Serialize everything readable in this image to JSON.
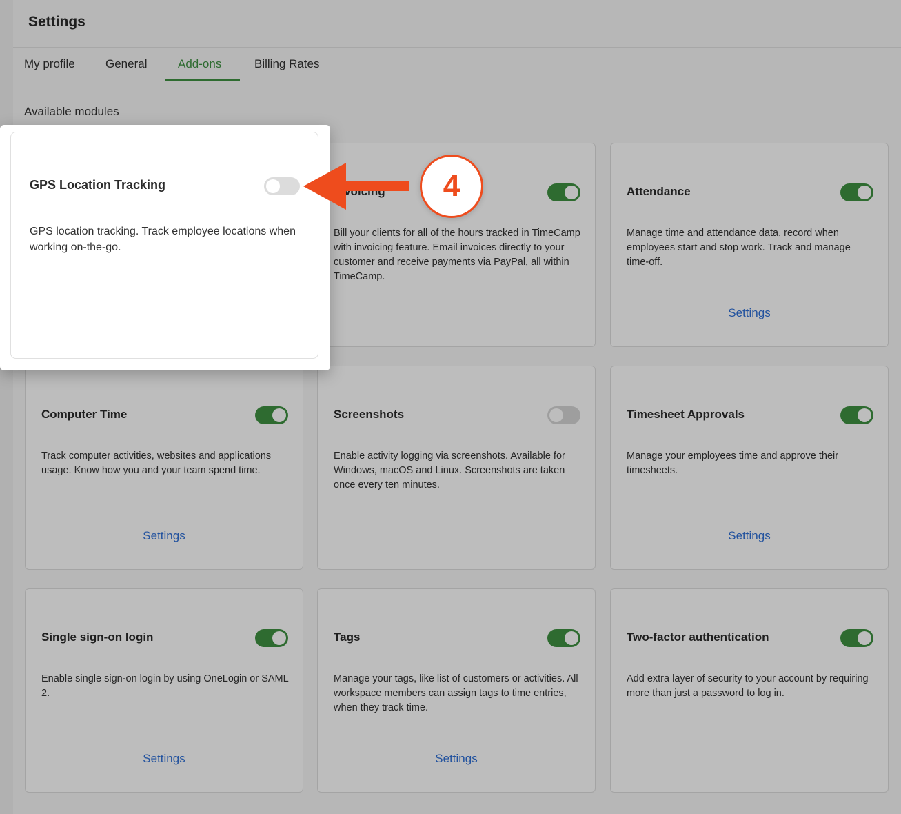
{
  "page": {
    "title": "Settings"
  },
  "tabs": [
    {
      "label": "My profile",
      "active": false
    },
    {
      "label": "General",
      "active": false
    },
    {
      "label": "Add-ons",
      "active": true
    },
    {
      "label": "Billing Rates",
      "active": false
    }
  ],
  "section_label": "Available modules",
  "modules": [
    {
      "title": "GPS Location Tracking",
      "enabled": false,
      "description": "GPS location tracking. Track employee locations when working on-the-go.",
      "settings_label": ""
    },
    {
      "title": "Invoicing",
      "enabled": true,
      "description": "Bill your clients for all of the hours tracked in TimeCamp with invoicing feature. Email invoices directly to your customer and receive payments via PayPal, all within TimeCamp.",
      "settings_label": ""
    },
    {
      "title": "Attendance",
      "enabled": true,
      "description": "Manage time and attendance data, record when employees start and stop work. Track and manage time-off.",
      "settings_label": "Settings"
    },
    {
      "title": "Computer Time",
      "enabled": true,
      "description": "Track computer activities, websites and applications usage. Know how you and your team spend time.",
      "settings_label": "Settings"
    },
    {
      "title": "Screenshots",
      "enabled": false,
      "description": "Enable activity logging via screenshots. Available for Windows, macOS and Linux. Screenshots are taken once every ten minutes.",
      "settings_label": ""
    },
    {
      "title": "Timesheet Approvals",
      "enabled": true,
      "description": "Manage your employees time and approve their timesheets.",
      "settings_label": "Settings"
    },
    {
      "title": "Single sign-on login",
      "enabled": true,
      "description": "Enable single sign-on login by using OneLogin or SAML 2.",
      "settings_label": "Settings"
    },
    {
      "title": "Tags",
      "enabled": true,
      "description": "Manage your tags, like list of customers or activities. All workspace members can assign tags to time entries, when they track time.",
      "settings_label": "Settings"
    },
    {
      "title": "Two-factor authentication",
      "enabled": true,
      "description": "Add extra layer of security to your account by requiring more than just a password to log in.",
      "settings_label": ""
    }
  ],
  "annotation": {
    "step_number": "4",
    "color": "#ee4c1d"
  },
  "colors": {
    "accent_green": "#3f9142",
    "link_blue": "#2f6fd6",
    "toggle_off": "#d6d6d6"
  }
}
